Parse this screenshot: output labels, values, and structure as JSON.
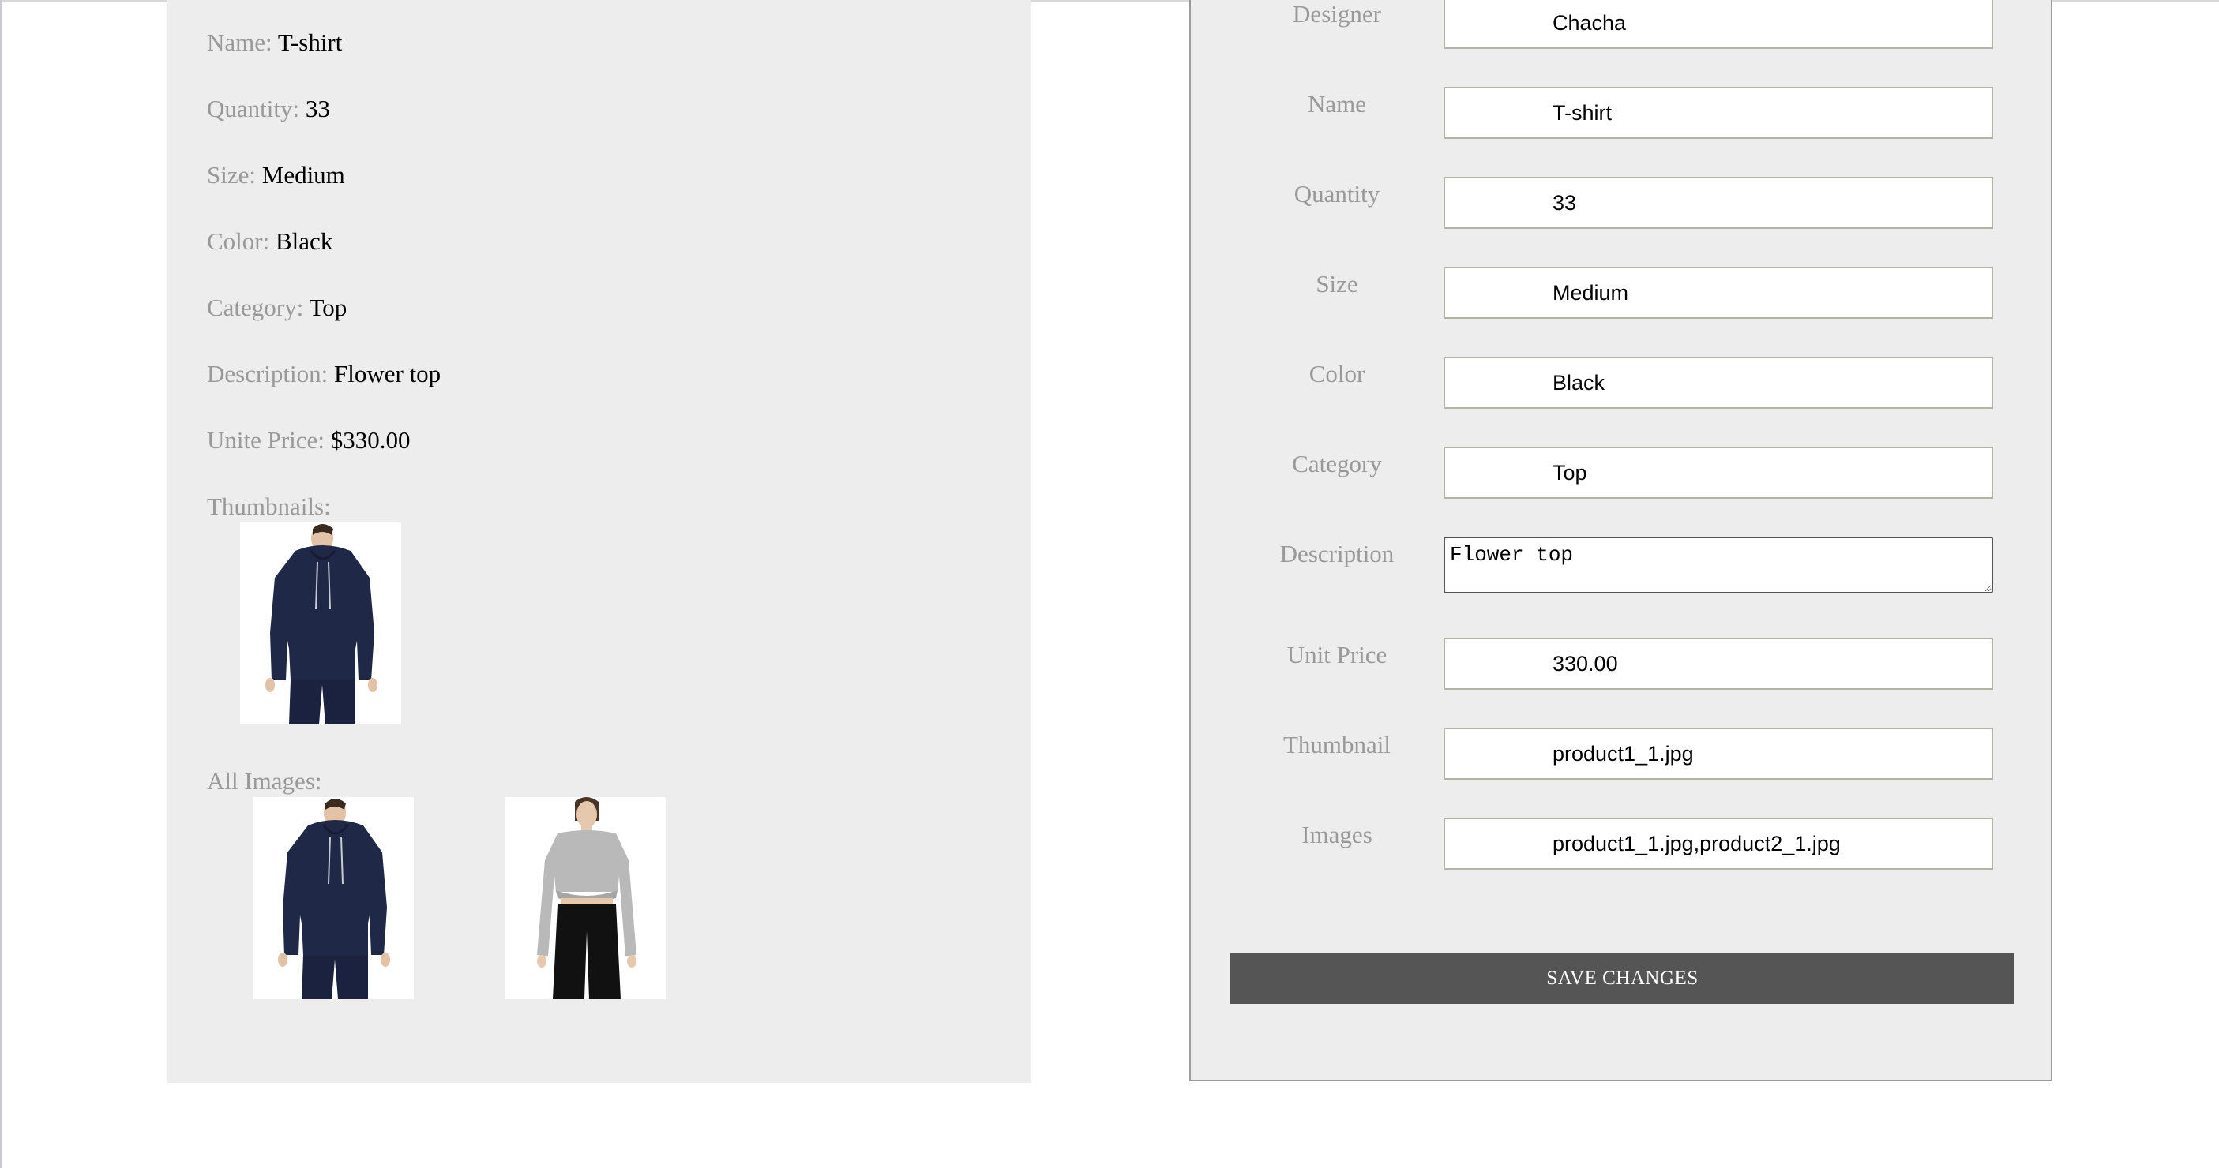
{
  "details": {
    "rows": [
      {
        "label": "Name:",
        "value": "T-shirt"
      },
      {
        "label": "Quantity:",
        "value": "33"
      },
      {
        "label": "Size:",
        "value": "Medium"
      },
      {
        "label": "Color:",
        "value": "Black"
      },
      {
        "label": "Category:",
        "value": "Top"
      },
      {
        "label": "Description:",
        "value": "Flower top"
      },
      {
        "label": "Unite Price:",
        "value": "$330.00"
      }
    ],
    "thumbnails_label": "Thumbnails:",
    "all_images_label": "All Images:"
  },
  "form": {
    "fields": [
      {
        "label": "Designer",
        "value": "Chacha"
      },
      {
        "label": "Name",
        "value": "T-shirt"
      },
      {
        "label": "Quantity",
        "value": "33"
      },
      {
        "label": "Size",
        "value": "Medium"
      },
      {
        "label": "Color",
        "value": "Black"
      },
      {
        "label": "Category",
        "value": "Top"
      },
      {
        "label": "Description",
        "value": "Flower top"
      },
      {
        "label": "Unit Price",
        "value": "330.00"
      },
      {
        "label": "Thumbnail",
        "value": "product1_1.jpg"
      },
      {
        "label": "Images",
        "value": "product1_1.jpg,product2_1.jpg"
      }
    ],
    "save_label": "SAVE CHANGES"
  },
  "colors": {
    "panel_bg": "#ededed",
    "label_gray": "#999999",
    "button_bg": "#555555",
    "navy_hoodie": "#1f2947",
    "gray_top": "#b9b9b9"
  }
}
